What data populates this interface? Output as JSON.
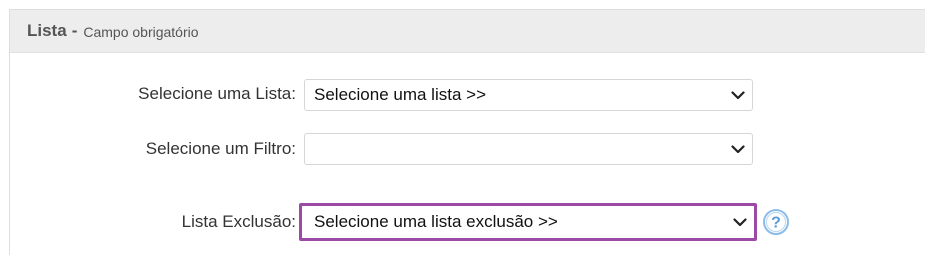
{
  "header": {
    "title": "Lista",
    "separator": "-",
    "subtitle": "Campo obrigatório"
  },
  "form": {
    "list": {
      "label": "Selecione uma Lista:",
      "value": "Selecione uma lista >>"
    },
    "filter": {
      "label": "Selecione um Filtro:",
      "value": ""
    },
    "exclusion": {
      "label": "Lista Exclusão:",
      "value": "Selecione uma lista exclusão >>"
    }
  },
  "icons": {
    "chevron": "chevron-down-icon",
    "help": "question-icon"
  },
  "colors": {
    "highlight_border": "#9b4aa5",
    "help_icon": "#5b9bd5",
    "header_bg": "#ededed"
  }
}
